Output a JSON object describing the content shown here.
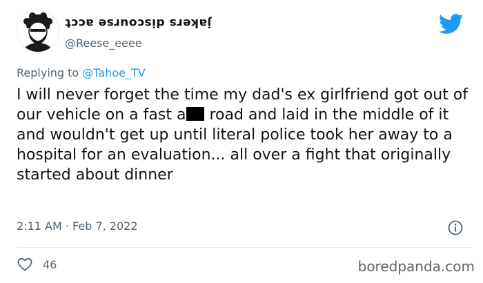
{
  "tweet": {
    "display_name": "jakers discourse acct",
    "handle": "@Reese_eeee",
    "replying_prefix": "Replying to ",
    "replying_to": "@Tahoe_TV",
    "text_part1": "I will never forget the time my dad's ex girlfriend got out of our vehicle on a fast a",
    "text_part2": " road and laid in the middle of it and wouldn't get up until literal police took her away to a hospital for an evaluation... all over a fight that originally started about dinner",
    "timestamp": "2:11 AM · Feb 7, 2022",
    "likes": "46"
  },
  "watermark": "boredpanda.com",
  "colors": {
    "twitter_blue": "#1d9bf0",
    "text": "#0f1419",
    "secondary": "#536471"
  },
  "icons": [
    "avatar",
    "twitter-bird-icon",
    "info-icon",
    "heart-icon"
  ]
}
